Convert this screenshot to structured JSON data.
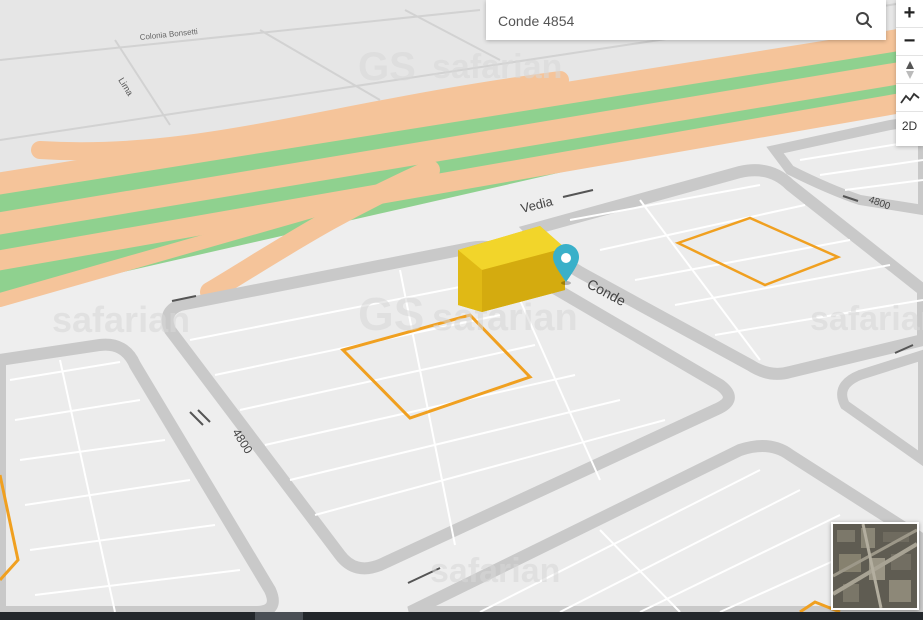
{
  "search": {
    "value": "Conde 4854",
    "button_icon": "search-icon"
  },
  "controls": {
    "zoom_in_label": "+",
    "zoom_out_label": "−",
    "compass_icon": "compass-icon",
    "profile_icon": "elevation-profile-icon",
    "mode_label": "2D"
  },
  "map": {
    "street_labels": {
      "vedia": "Vedia",
      "conde": "Conde",
      "n4800_left": "4800",
      "n4800_right": "4800",
      "lima": "Lima",
      "colonia_bonsetti": "Colonia Bonsetti"
    },
    "watermarks": [
      "safarian",
      "safarian",
      "safarian",
      "safarian",
      "safarian"
    ],
    "watermark_logo": "GS",
    "marker_icon": "location-pin-icon",
    "building_color": "#e8c21a",
    "parcel_outline_color": "#f0a020",
    "highway_color": "#f5c49a",
    "green_color": "#8fd18f"
  },
  "minimap": {
    "icon": "satellite-thumbnail-icon"
  }
}
